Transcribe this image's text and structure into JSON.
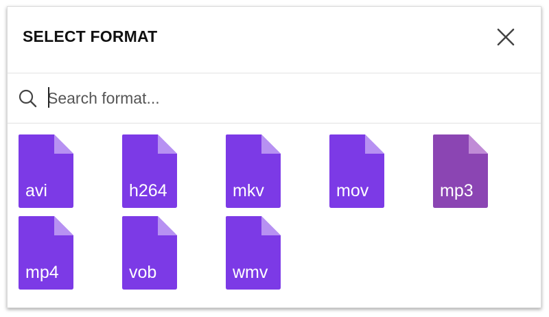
{
  "dialog": {
    "title": "SELECT FORMAT",
    "close_icon": "close-icon"
  },
  "search": {
    "icon": "search-icon",
    "placeholder": "Search format...",
    "value": ""
  },
  "formats": [
    {
      "label": "avi",
      "color": "#7c3ae6",
      "fold": "#b791f2",
      "selected": false
    },
    {
      "label": "h264",
      "color": "#7c3ae6",
      "fold": "#b791f2",
      "selected": false
    },
    {
      "label": "mkv",
      "color": "#7c3ae6",
      "fold": "#b791f2",
      "selected": false
    },
    {
      "label": "mov",
      "color": "#7c3ae6",
      "fold": "#b791f2",
      "selected": false
    },
    {
      "label": "mp3",
      "color": "#8b45b3",
      "fold": "#c08bd6",
      "selected": true
    },
    {
      "label": "mp4",
      "color": "#7c3ae6",
      "fold": "#b791f2",
      "selected": false
    },
    {
      "label": "vob",
      "color": "#7c3ae6",
      "fold": "#b791f2",
      "selected": false
    },
    {
      "label": "wmv",
      "color": "#7c3ae6",
      "fold": "#b791f2",
      "selected": false
    }
  ]
}
